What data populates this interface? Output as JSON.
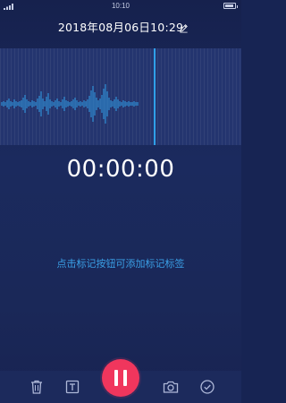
{
  "status_bar": {
    "time": "10:10"
  },
  "header": {
    "title": "2018年08月06日10:29"
  },
  "recorder": {
    "elapsed": "00:00:00",
    "hint": "点击标记按钮可添加标记标签",
    "waveform": [
      2,
      3,
      2,
      4,
      6,
      3,
      2,
      5,
      3,
      2,
      3,
      4,
      7,
      10,
      5,
      3,
      2,
      4,
      3,
      2,
      6,
      9,
      14,
      6,
      3,
      8,
      12,
      5,
      3,
      2,
      4,
      6,
      3,
      2,
      5,
      8,
      4,
      3,
      2,
      3,
      5,
      7,
      4,
      2,
      3,
      2,
      4,
      3,
      5,
      9,
      15,
      20,
      13,
      7,
      4,
      6,
      10,
      17,
      22,
      14,
      7,
      4,
      3,
      5,
      8,
      5,
      3,
      2,
      4,
      3,
      2,
      3,
      2,
      2,
      3,
      2,
      2
    ]
  },
  "colors": {
    "accent": "#f0365d",
    "playhead": "#2f9fe8",
    "waveform": "#2f9fe8",
    "hint": "#3a9fe6"
  },
  "toolbar": {
    "icons": [
      "trash-icon",
      "text-icon",
      "pause-icon",
      "camera-icon",
      "check-icon"
    ]
  }
}
